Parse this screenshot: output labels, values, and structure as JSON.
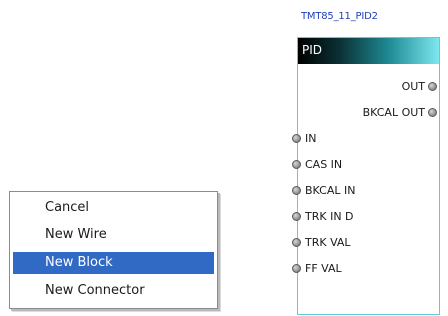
{
  "block": {
    "title": "TMT85_11_PID2",
    "header": "PID",
    "outputs": [
      {
        "label": "OUT"
      },
      {
        "label": "BKCAL OUT"
      }
    ],
    "inputs": [
      {
        "label": "IN"
      },
      {
        "label": "CAS IN"
      },
      {
        "label": "BKCAL IN"
      },
      {
        "label": "TRK IN D"
      },
      {
        "label": "TRK VAL"
      },
      {
        "label": "FF VAL"
      }
    ],
    "colors": {
      "title": "#1f3fb8",
      "border": "#63c8d8",
      "header_start": "#000000",
      "header_end": "#7ee6ee"
    },
    "connector_icon": "connector-circle-icon"
  },
  "context_menu": {
    "items": [
      {
        "label": "Cancel",
        "selected": false
      },
      {
        "label": "New Wire",
        "selected": false
      },
      {
        "label": "New Block",
        "selected": true
      },
      {
        "label": "New Connector",
        "selected": false
      }
    ],
    "selection_color": "#316ac5"
  }
}
